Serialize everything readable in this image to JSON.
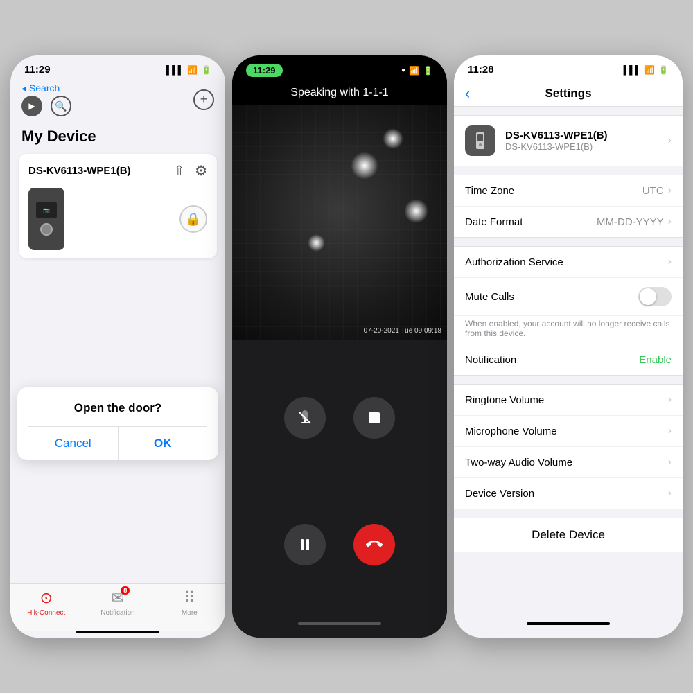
{
  "left_screen": {
    "status_time": "11:29",
    "status_arrow": "↗",
    "nav_back": "◂ Search",
    "section_title": "My Device",
    "device_name": "DS-KV6113-WPE1(B)",
    "dialog": {
      "title": "Open the door?",
      "cancel": "Cancel",
      "confirm": "OK"
    },
    "tabs": [
      {
        "id": "hik-connect",
        "label": "Hik-Connect",
        "active": true
      },
      {
        "id": "notification",
        "label": "Notification",
        "active": false,
        "badge": "8"
      },
      {
        "id": "more",
        "label": "More",
        "active": false
      }
    ]
  },
  "middle_screen": {
    "status_time": "11:29",
    "call_title": "Speaking with 1-1-1",
    "timestamp": "07-20-2021 Tue 09:09:18",
    "home_indicator": true
  },
  "right_screen": {
    "status_time": "11:28",
    "status_arrow": "↗",
    "nav_title": "Settings",
    "device_name": "DS-KV6113-WPE1(B)",
    "device_model": "DS-KV6113-WPE1(B)",
    "settings": [
      {
        "id": "time-zone",
        "label": "Time Zone",
        "value": "UTC",
        "type": "nav"
      },
      {
        "id": "date-format",
        "label": "Date Format",
        "value": "MM-DD-YYYY",
        "type": "nav"
      },
      {
        "id": "auth-service",
        "label": "Authorization Service",
        "value": "",
        "type": "nav"
      },
      {
        "id": "mute-calls",
        "label": "Mute Calls",
        "value": "",
        "type": "toggle"
      },
      {
        "id": "mute-desc",
        "label": "When enabled, your account will no longer receive calls from this device.",
        "value": "",
        "type": "desc"
      },
      {
        "id": "notification",
        "label": "Notification",
        "value": "Enable",
        "type": "green"
      },
      {
        "id": "ringtone-volume",
        "label": "Ringtone Volume",
        "value": "",
        "type": "nav"
      },
      {
        "id": "microphone-volume",
        "label": "Microphone Volume",
        "value": "",
        "type": "nav"
      },
      {
        "id": "two-way-audio",
        "label": "Two-way Audio Volume",
        "value": "",
        "type": "nav"
      },
      {
        "id": "device-version",
        "label": "Device Version",
        "value": "",
        "type": "nav"
      }
    ],
    "delete_label": "Delete Device"
  }
}
